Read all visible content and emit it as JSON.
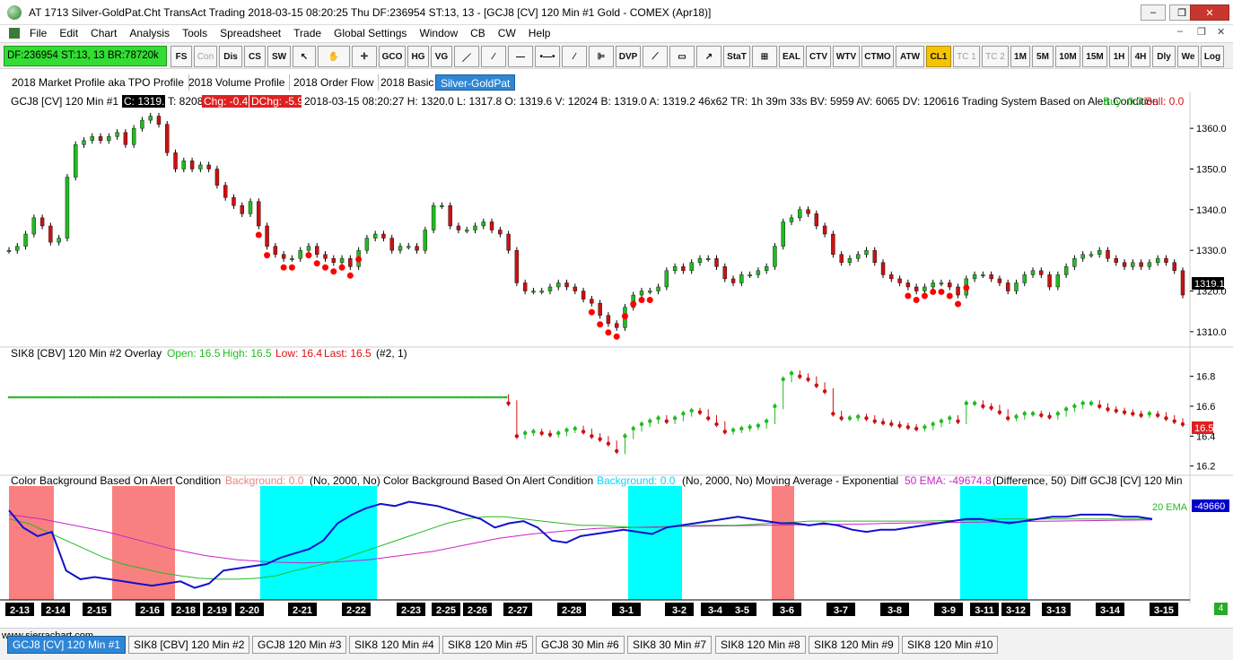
{
  "window": {
    "title": "AT 1713 Silver-GoldPat.Cht  TransAct Trading 2018-03-15  08:20:25 Thu  DF:236954  ST:13, 13  - [GCJ8 [CV]  120 Min  #1  Gold - COMEX (Apr18)]",
    "min_btn": "–",
    "max_btn": "❐",
    "close_btn": "✕"
  },
  "menu": [
    "File",
    "Edit",
    "Chart",
    "Analysis",
    "Tools",
    "Spreadsheet",
    "Trade",
    "Global Settings",
    "Window",
    "CB",
    "CW",
    "Help"
  ],
  "menu_mdi": [
    "–",
    "❐",
    "✕"
  ],
  "status_box": "DF:236954  ST:13, 13  BR:78720k",
  "toolbar": [
    "FS",
    "Con",
    "Dis",
    "CS",
    "SW",
    "↖",
    "✋",
    "✛",
    "GCO",
    "HG",
    "VG",
    "／",
    "⁄",
    "—",
    "•—•",
    "⁄",
    "⊫",
    "DVP",
    "⟋",
    "▭",
    "↗",
    "StaT",
    "⊞",
    "EAL",
    "CTV",
    "WTV",
    "CTMO",
    "ATW",
    "CL1",
    "TC 1",
    "TC 2",
    "1M",
    "5M",
    "10M",
    "15M",
    "1H",
    "4H",
    "Dly",
    "We",
    "Log"
  ],
  "tabs": [
    "2018 Market Profile aka TPO Profile",
    "2018 Volume Profile",
    "2018 Order Flow",
    "2018 Basic",
    "Silver-GoldPat"
  ],
  "header1": {
    "symbol": "GCJ8 [CV]  120 Min  #1",
    "close": "C: 1319.1",
    "t": "T: 8208",
    "chg": "Chg: -0.4",
    "dchg": "DChg: -5.9",
    "details": "2018-03-15  08:20:27 H: 1320.0  L: 1317.8  O: 1319.6  V: 12024  B: 1319.0  A: 1319.2  46x62  TR: 1h 39m 33s  BV: 5959  AV: 6065  DV: 120616  Trading System Based on Alert Condition",
    "buy": "Buy: 0.0",
    "sell": "Sell: 0.0"
  },
  "header2": {
    "symbol": "SIK8 [CBV]  120 Min  #2 Overlay",
    "open": "Open: 16.5",
    "high": "High: 16.5",
    "low": "Low: 16.4",
    "last": "Last: 16.5",
    "extra": "(#2, 1)"
  },
  "header3": {
    "a": "Color Background Based On Alert Condition",
    "a_val": "Background: 0.0",
    "a_params": "(No, 2000, No)",
    "b": "Color Background Based On Alert Condition",
    "b_val": "Background: 0.0",
    "b_params": "(No, 2000, No)",
    "c": "Moving Average - Exponential",
    "c_val": "50 EMA: -49674.8",
    "c_params": "(Difference, 50)",
    "d": "Diff GCJ8 [CV]  120 Min"
  },
  "chart_data": [
    {
      "type": "line",
      "title": "GCJ8 [CV] 120 Min #1",
      "y_ticks": [
        "1360.0",
        "1350.0",
        "1340.0",
        "1330.0",
        "1320.0",
        "1310.0"
      ],
      "last_price": "1319.1",
      "ylim": [
        1306,
        1364
      ],
      "colors": {
        "up": "#22bb22",
        "down": "#cc1111",
        "signal": "#ff0000"
      },
      "series": [
        {
          "values": [
            1330,
            1331,
            1334,
            1338,
            1336,
            1332,
            1333,
            1348,
            1356,
            1357,
            1358,
            1357,
            1358,
            1359,
            1356,
            1360,
            1362,
            1363,
            1361,
            1354,
            1350,
            1352,
            1350,
            1351,
            1350,
            1346,
            1343,
            1341,
            1339,
            1342,
            1336,
            1331,
            1329,
            1328,
            1328,
            1330,
            1331,
            1329,
            1328,
            1327,
            1328,
            1326,
            1330,
            1333,
            1334,
            1333,
            1330,
            1331,
            1331,
            1330,
            1335,
            1341,
            1341,
            1336,
            1335,
            1335,
            1336,
            1337,
            1335,
            1334,
            1330,
            1322,
            1320,
            1320,
            1320,
            1321,
            1322,
            1321,
            1320,
            1318,
            1317,
            1314,
            1312,
            1311,
            1316,
            1319,
            1320,
            1320,
            1321,
            1325,
            1326,
            1325,
            1327,
            1328,
            1328,
            1326,
            1323,
            1322,
            1324,
            1324,
            1325,
            1326,
            1331,
            1337,
            1338,
            1340,
            1339,
            1336,
            1334,
            1329,
            1327,
            1328,
            1329,
            1330,
            1327,
            1324,
            1323,
            1322,
            1321,
            1320,
            1321,
            1322,
            1322,
            1321,
            1319,
            1323,
            1324,
            1324,
            1323,
            1322,
            1320,
            1322,
            1324,
            1325,
            1324,
            1321,
            1324,
            1326,
            1328,
            1329,
            1329,
            1330,
            1328,
            1327,
            1326,
            1327,
            1326,
            1327,
            1328,
            1327,
            1325,
            1319
          ]
        }
      ]
    },
    {
      "type": "line",
      "title": "SIK8 [CBV] 120 Min #2 Overlay",
      "y_ticks": [
        "16.8",
        "16.6",
        "16.4",
        "16.2"
      ],
      "last_price": "16.5",
      "ylim": [
        16.15,
        16.9
      ],
      "color": "#22bb22",
      "series": [
        {
          "values": [
            16.66,
            16.66,
            16.66,
            16.66,
            16.66,
            16.66,
            16.66,
            16.66,
            16.66,
            16.66,
            16.66,
            16.66,
            16.66,
            16.66,
            16.66,
            16.66,
            16.66,
            16.66,
            16.66,
            16.66,
            16.66,
            16.66,
            16.66,
            16.66,
            16.66,
            16.66,
            16.66,
            16.66,
            16.66,
            16.66,
            16.66,
            16.66,
            16.66,
            16.66,
            16.66,
            16.66,
            16.66,
            16.66,
            16.66,
            16.66,
            16.66,
            16.66,
            16.66,
            16.66,
            16.66,
            16.66,
            16.66,
            16.66,
            16.66,
            16.66,
            16.66,
            16.66,
            16.66,
            16.66,
            16.66,
            16.66,
            16.66,
            16.66,
            16.66,
            16.66,
            16.62,
            16.4,
            16.42,
            16.43,
            16.42,
            16.41,
            16.42,
            16.44,
            16.45,
            16.43,
            16.4,
            16.38,
            16.35,
            16.3,
            16.4,
            16.45,
            16.48,
            16.5,
            16.52,
            16.5,
            16.52,
            16.55,
            16.57,
            16.56,
            16.52,
            16.48,
            16.43,
            16.44,
            16.45,
            16.46,
            16.47,
            16.5,
            16.6,
            16.78,
            16.82,
            16.8,
            16.78,
            16.74,
            16.7,
            16.55,
            16.52,
            16.52,
            16.53,
            16.52,
            16.5,
            16.49,
            16.48,
            16.47,
            16.46,
            16.45,
            16.46,
            16.48,
            16.5,
            16.52,
            16.5,
            16.62,
            16.62,
            16.6,
            16.59,
            16.56,
            16.52,
            16.53,
            16.55,
            16.55,
            16.54,
            16.53,
            16.55,
            16.58,
            16.6,
            16.62,
            16.62,
            16.6,
            16.58,
            16.57,
            16.56,
            16.55,
            16.54,
            16.55,
            16.54,
            16.52,
            16.5,
            16.48
          ]
        }
      ]
    },
    {
      "type": "line",
      "title": "Diff GCJ8 [CV] 120 Min",
      "ema_label": "20 EMA",
      "last_value": "-49660",
      "colors": {
        "diff": "#1111cc",
        "ema20": "#22bb22",
        "ema50": "#cc22cc",
        "bg_red": "#f98080",
        "bg_cyan": "#00ffff"
      },
      "series": [
        {
          "name": "Diff GCJ8 [CV] 120 Min",
          "values": [
            0.8,
            0.4,
            0.2,
            0.3,
            -0.6,
            -0.8,
            -0.75,
            -0.8,
            -0.85,
            -0.9,
            -0.95,
            -0.9,
            -0.85,
            -1.0,
            -0.9,
            -0.6,
            -0.55,
            -0.5,
            -0.45,
            -0.3,
            -0.2,
            -0.1,
            0.1,
            0.5,
            0.7,
            0.85,
            0.95,
            0.9,
            1.0,
            0.95,
            0.9,
            0.8,
            0.7,
            0.6,
            0.4,
            0.5,
            0.55,
            0.4,
            0.1,
            0.05,
            0.2,
            0.25,
            0.3,
            0.35,
            0.3,
            0.25,
            0.4,
            0.45,
            0.5,
            0.55,
            0.6,
            0.65,
            0.6,
            0.55,
            0.5,
            0.5,
            0.45,
            0.5,
            0.45,
            0.35,
            0.3,
            0.35,
            0.35,
            0.4,
            0.45,
            0.5,
            0.55,
            0.6,
            0.6,
            0.55,
            0.5,
            0.55,
            0.6,
            0.65,
            0.65,
            0.7,
            0.7,
            0.7,
            0.65,
            0.65,
            0.6
          ]
        },
        {
          "name": "20 EMA",
          "values": [
            0.6,
            0.5,
            0.3,
            0.1,
            -0.1,
            -0.3,
            -0.45,
            -0.55,
            -0.65,
            -0.72,
            -0.78,
            -0.8,
            -0.8,
            -0.78,
            -0.72,
            -0.6,
            -0.5,
            -0.4,
            -0.25,
            -0.1,
            0.05,
            0.2,
            0.35,
            0.5,
            0.6,
            0.65,
            0.65,
            0.6,
            0.55,
            0.5,
            0.45,
            0.45,
            0.42,
            0.4,
            0.4,
            0.42,
            0.45,
            0.45,
            0.45,
            0.47,
            0.5,
            0.52,
            0.55,
            0.55,
            0.55,
            0.55,
            0.55,
            0.55,
            0.55,
            0.56,
            0.57,
            0.58,
            0.6,
            0.6,
            0.6,
            0.6,
            0.6,
            0.6,
            0.6,
            0.6,
            0.6
          ]
        },
        {
          "name": "50 EMA",
          "values": [
            0.7,
            0.6,
            0.45,
            0.3,
            0.1,
            -0.1,
            -0.25,
            -0.35,
            -0.4,
            -0.42,
            -0.4,
            -0.35,
            -0.25,
            -0.15,
            0.0,
            0.15,
            0.25,
            0.32,
            0.38,
            0.4,
            0.42,
            0.43,
            0.44,
            0.45,
            0.46,
            0.47,
            0.48,
            0.5,
            0.51,
            0.52,
            0.53,
            0.54,
            0.55,
            0.56,
            0.57,
            0.58
          ]
        }
      ]
    }
  ],
  "x_labels": [
    "2-13",
    "2-14",
    "2-15",
    "2-16",
    "2-18",
    "2-19",
    "2-20",
    "2-21",
    "2-22",
    "2-23",
    "2-25",
    "2-26",
    "2-27",
    "2-28",
    "3-1",
    "3-2",
    "3-4",
    "3-5",
    "3-6",
    "3-7",
    "3-8",
    "3-9",
    "3-11",
    "3-12",
    "3-13",
    "3-14",
    "3-15"
  ],
  "footer": {
    "url": "www.sierrachart.com",
    "badge": "4",
    "tabs": [
      "GCJ8 [CV]  120 Min  #1",
      "SIK8 [CBV]  120 Min  #2",
      "GCJ8  120 Min  #3",
      "SIK8  120 Min  #4",
      "SIK8  120 Min  #5",
      "GCJ8  30 Min  #6",
      "SIK8  30 Min  #7",
      "SIK8  120 Min  #8",
      "SIK8  120 Min  #9",
      "SIK8  120 Min  #10"
    ]
  }
}
